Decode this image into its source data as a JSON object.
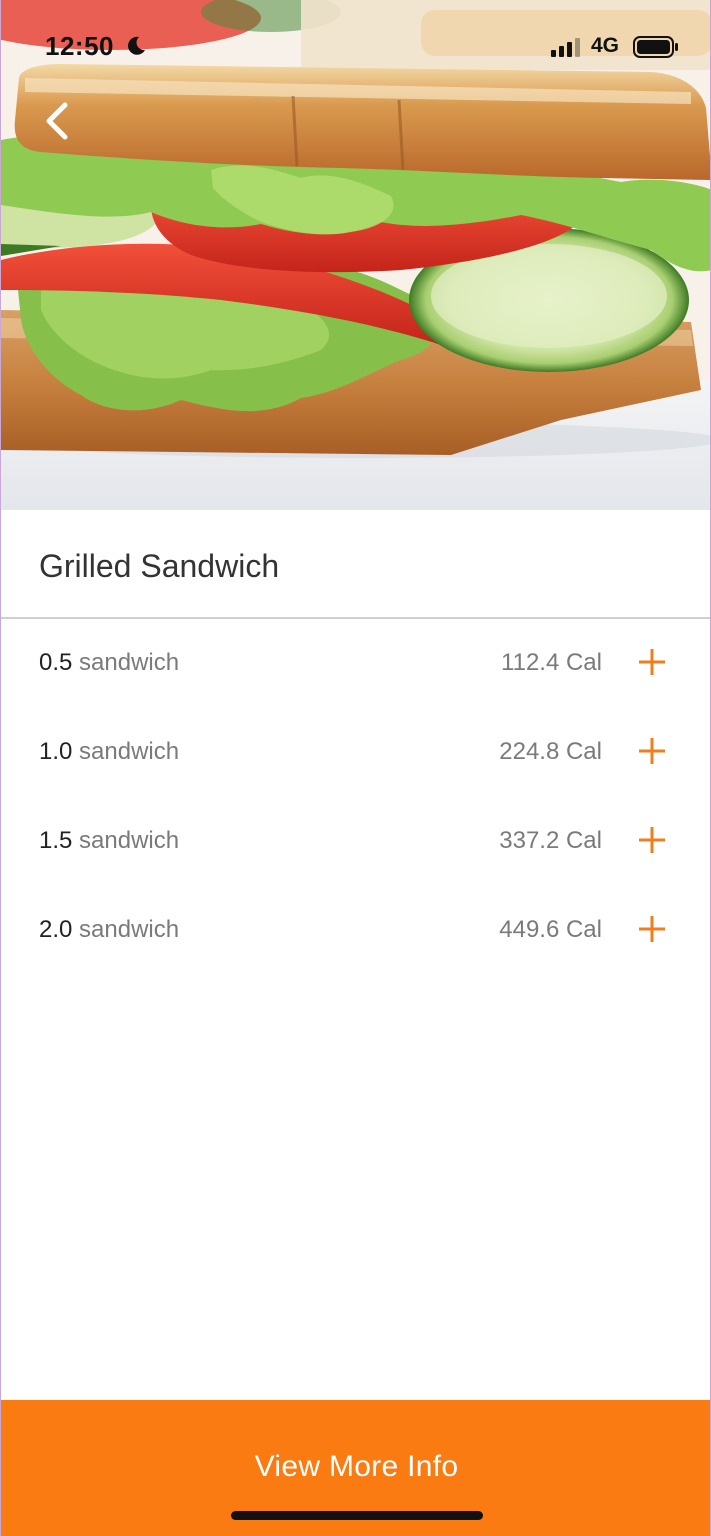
{
  "status_bar": {
    "time": "12:50",
    "network": "4G",
    "icons": [
      "moon-icon",
      "cellular-signal-icon",
      "battery-icon"
    ]
  },
  "hero": {
    "image": "sandwich-photo",
    "back_icon": "chevron-left-icon"
  },
  "food": {
    "title": "Grilled Sandwich"
  },
  "servings": [
    {
      "amount": "0.5",
      "unit": "sandwich",
      "calories": "112.4 Cal",
      "action_icon": "plus-icon"
    },
    {
      "amount": "1.0",
      "unit": "sandwich",
      "calories": "224.8 Cal",
      "action_icon": "plus-icon"
    },
    {
      "amount": "1.5",
      "unit": "sandwich",
      "calories": "337.2 Cal",
      "action_icon": "plus-icon"
    },
    {
      "amount": "2.0",
      "unit": "sandwich",
      "calories": "449.6 Cal",
      "action_icon": "plus-icon"
    }
  ],
  "footer": {
    "button_label": "View More Info"
  },
  "colors": {
    "accent": "#f97b12",
    "title_text": "#333333",
    "muted_text": "#7a7a7a",
    "divider": "#cfcfcf"
  }
}
